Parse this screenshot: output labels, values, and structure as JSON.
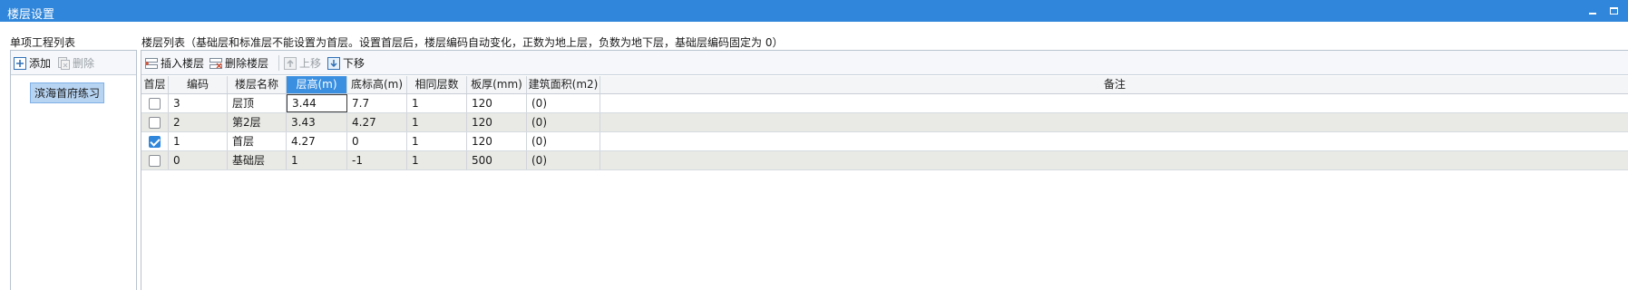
{
  "window": {
    "title": "楼层设置"
  },
  "left": {
    "title": "单项工程列表",
    "toolbar": {
      "add_label": "添加",
      "delete_label": "删除"
    },
    "projects": [
      {
        "label": "滨海首府练习",
        "selected": true
      }
    ]
  },
  "right": {
    "title": "楼层列表（基础层和标准层不能设置为首层。设置首层后，楼层编码自动变化，正数为地上层，负数为地下层，基础层编码固定为 0）",
    "toolbar": {
      "insert_label": "插入楼层",
      "delete_label": "删除楼层",
      "up_label": "上移",
      "down_label": "下移"
    },
    "columns": [
      "首层",
      "编码",
      "楼层名称",
      "层高(m)",
      "底标高(m)",
      "相同层数",
      "板厚(mm)",
      "建筑面积(m2)",
      "备注"
    ],
    "active_column": "层高(m)",
    "rows": [
      {
        "first": false,
        "code": "3",
        "name": "层顶",
        "height": "3.44",
        "base": "7.7",
        "same": "1",
        "thick": "120",
        "area": "(0)",
        "note": ""
      },
      {
        "first": false,
        "code": "2",
        "name": "第2层",
        "height": "3.43",
        "base": "4.27",
        "same": "1",
        "thick": "120",
        "area": "(0)",
        "note": ""
      },
      {
        "first": true,
        "code": "1",
        "name": "首层",
        "height": "4.27",
        "base": "0",
        "same": "1",
        "thick": "120",
        "area": "(0)",
        "note": ""
      },
      {
        "first": false,
        "code": "0",
        "name": "基础层",
        "height": "1",
        "base": "-1",
        "same": "1",
        "thick": "500",
        "area": "(0)",
        "note": ""
      }
    ]
  },
  "colors": {
    "titlebar": "#2f86da",
    "active_header": "#3a8fe0",
    "alt_row": "#e9e9e5",
    "selected_item": "#b7d4f3"
  }
}
